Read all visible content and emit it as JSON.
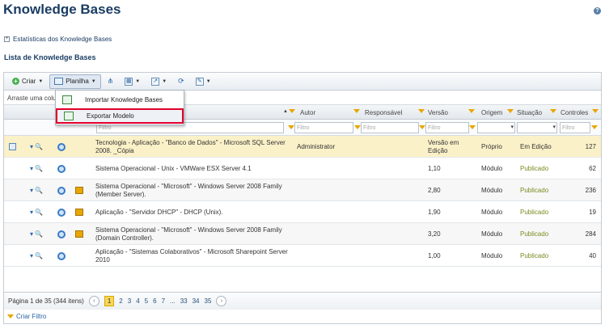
{
  "page": {
    "title": "Knowledge Bases",
    "help_icon": "help-icon"
  },
  "stats_link": "Estatísticas dos Knowledge Bases",
  "list_title": "Lista de Knowledge Bases",
  "toolbar": {
    "create_label": "Criar",
    "sheet_label": "Planilha"
  },
  "menu": {
    "items": [
      {
        "label": "Importar Knowledge Bases"
      },
      {
        "label": "Exportar Modelo"
      }
    ]
  },
  "group_bar": "Arraste uma colu",
  "columns": {
    "author": "Autor",
    "responsible": "Responsável",
    "version": "Versão",
    "origin": "Origem",
    "situation": "Situação",
    "controls": "Controles"
  },
  "filter_placeholder": "Filtro",
  "rows": [
    {
      "name": "Tecnologia - Aplicação - \"Banco de Dados\" - Microsoft SQL Server 2008. _Cópia",
      "author": "Administrator",
      "version": "Versão em Edição",
      "origin": "Próprio",
      "situation": "Em Edição",
      "controls": "127"
    },
    {
      "name": "Sistema Operacional - Unix - VMWare ESX Server 4.1",
      "author": "",
      "version": "1,10",
      "origin": "Módulo",
      "situation": "Publicado",
      "controls": "62"
    },
    {
      "name": "Sistema Operacional - \"Microsoft\" - Windows Server 2008 Family (Member Server).",
      "author": "",
      "version": "2,80",
      "origin": "Módulo",
      "situation": "Publicado",
      "controls": "236"
    },
    {
      "name": "Aplicação - \"Servidor DHCP\" - DHCP (Unix).",
      "author": "",
      "version": "1,90",
      "origin": "Módulo",
      "situation": "Publicado",
      "controls": "19"
    },
    {
      "name": "Sistema Operacional - \"Microsoft\" - Windows Server 2008 Family (Domain Controller).",
      "author": "",
      "version": "3,20",
      "origin": "Módulo",
      "situation": "Publicado",
      "controls": "284"
    },
    {
      "name": "Aplicação - \"Sistemas Colaborativos\" - Microsoft Sharepoint Server 2010",
      "author": "",
      "version": "1,00",
      "origin": "Módulo",
      "situation": "Publicado",
      "controls": "40"
    }
  ],
  "pager": {
    "info": "Página 1 de 35 (344 itens)",
    "pages": [
      "1",
      "2",
      "3",
      "4",
      "5",
      "6",
      "7",
      "...",
      "33",
      "34",
      "35"
    ]
  },
  "footer": {
    "create_filter": "Criar Filtro"
  }
}
